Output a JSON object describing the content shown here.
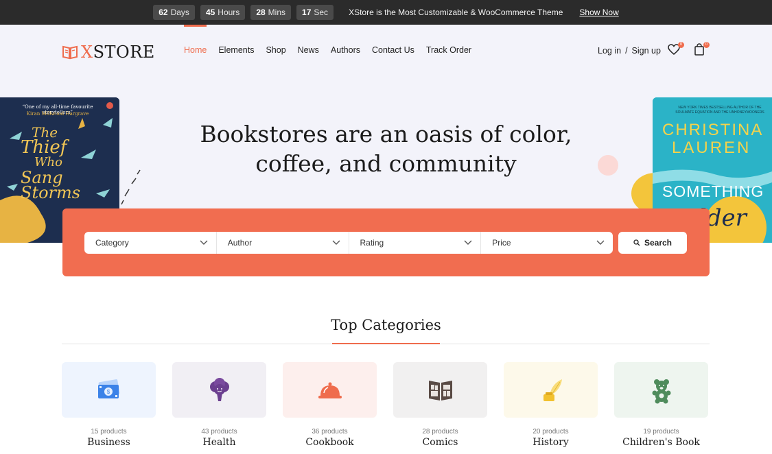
{
  "countdown": {
    "days_value": "62",
    "days_unit": "Days",
    "hours_value": "45",
    "hours_unit": "Hours",
    "mins_value": "28",
    "mins_unit": "Mins",
    "sec_value": "17",
    "sec_unit": "Sec"
  },
  "promo": {
    "text": "XStore is the Most Customizable & WooCommerce Theme",
    "link": "Show Now"
  },
  "logo": {
    "prefix": "X",
    "rest": "STORE"
  },
  "nav": [
    "Home",
    "Elements",
    "Shop",
    "News",
    "Authors",
    "Contact Us",
    "Track Order"
  ],
  "nav_active": "Home",
  "account": {
    "login": "Log in",
    "separator": "/",
    "signup": "Sign up"
  },
  "wishlist_count": "0",
  "cart_count": "0",
  "headline": {
    "line1": "Bookstores are an oasis of color,",
    "line2": "coffee, and community"
  },
  "book_left": {
    "quote": "“One of my all-time favourite storytellers”",
    "quote_author": "Kiran Millwood Hargrave",
    "title": [
      "The",
      "Thief",
      "Who",
      "Sang",
      "Storms"
    ]
  },
  "book_right": {
    "tagline": "NEW YORK TIMES BESTSELLING AUTHOR OF THE SOULMATE EQUATION AND THE UNHONEYMOONERS",
    "author": [
      "CHRISTINA",
      "LAUREN"
    ],
    "title": [
      "SOMETHING",
      "Older"
    ]
  },
  "filters": [
    {
      "label": "Category"
    },
    {
      "label": "Author"
    },
    {
      "label": "Rating"
    },
    {
      "label": "Price"
    }
  ],
  "search_label": "Search",
  "categories_title": "Top Categories",
  "categories": [
    {
      "count": "15 products",
      "name": "Business",
      "icon": "money-icon",
      "bg": "#eef4fe"
    },
    {
      "count": "43 products",
      "name": "Health",
      "icon": "broccoli-icon",
      "bg": "#f1eff4"
    },
    {
      "count": "36 products",
      "name": "Cookbook",
      "icon": "cloche-icon",
      "bg": "#fdefed"
    },
    {
      "count": "28 products",
      "name": "Comics",
      "icon": "comic-book-icon",
      "bg": "#f1f0f0"
    },
    {
      "count": "20 products",
      "name": "History",
      "icon": "quill-ink-icon",
      "bg": "#fdf9ea"
    },
    {
      "count": "19 products",
      "name": "Children's Book",
      "icon": "teddy-bear-icon",
      "bg": "#eef5ef"
    }
  ],
  "colors": {
    "accent": "#ef6c4d",
    "topbar": "#2b2b2b",
    "hero_bg": "#f3f3fa"
  }
}
